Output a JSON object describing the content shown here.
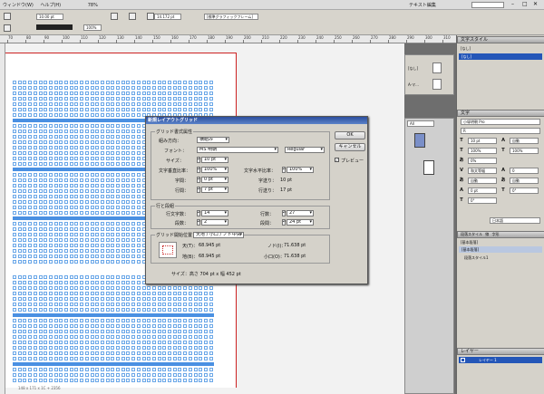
{
  "menubar": {
    "items": [
      "ウィンドウ(W)",
      "ヘルプ(H)"
    ],
    "zoom": "78%",
    "workspace": "テキスト編集"
  },
  "toolbar": {
    "font_size": "10.00 pt",
    "leading": "14.172 pt",
    "frame_type": "[標準グラフィックフレーム]",
    "percent": "100%"
  },
  "ruler": {
    "labels": [
      "70",
      "80",
      "90",
      "100",
      "110",
      "120",
      "130",
      "140",
      "150",
      "160",
      "170",
      "180",
      "190",
      "200",
      "210",
      "220",
      "230",
      "240",
      "250",
      "260",
      "270",
      "280",
      "290",
      "300",
      "310"
    ]
  },
  "status": {
    "text": "148 x 171 x 1C + 2356"
  },
  "dialog": {
    "title": "新規レイアウトグリッド",
    "grid_attrs_label": "グリッド書式属性",
    "direction_label": "組み方向：",
    "direction_value": "横組み",
    "font_label": "フォント：",
    "font_value": "MS 明朝",
    "style_value": "Regular",
    "size_label": "サイズ：",
    "size_value": "10 pt",
    "vscale_label": "文字垂直比率：",
    "vscale_value": "100%",
    "hscale_label": "文字水平比率：",
    "hscale_value": "100%",
    "charspace_label": "字間：",
    "charspace_value": "0 pt",
    "charspace_send_label": "字送り：",
    "charspace_send_value": "10 pt",
    "linespace_label": "行間：",
    "linespace_value": "7 pt",
    "linespace_send_label": "行送り：",
    "linespace_send_value": "17 pt",
    "lines_label": "行と段組",
    "chars_per_line_label": "行文字数：",
    "chars_per_line_value": "14",
    "lines_count_label": "行数：",
    "lines_count_value": "27",
    "columns_label": "段数：",
    "columns_value": "2",
    "gutter_label": "段間：",
    "gutter_value": "24 pt",
    "start_label": "グリッド開始位置",
    "start_value": "天地 / 小口 / ノド中央",
    "top_label": "天(T)：",
    "top_value": "68.945 pt",
    "inside_label": "ノド(I)：",
    "inside_value": "71.638 pt",
    "bottom_label": "地(B)：",
    "bottom_value": "68.945 pt",
    "outside_label": "小口(O)：",
    "outside_value": "71.638 pt",
    "size_summary": "サイズ：高さ 704 pt x 幅 452 pt",
    "ok": "OK",
    "cancel": "キャンセル",
    "preview": "プレビュー"
  },
  "pages_panel": {
    "none_label": "[なし]",
    "master_label": "A-マ..."
  },
  "mini_panel": {
    "tab": "All"
  },
  "char_style": {
    "title": "文字スタイル",
    "item": "[なし]",
    "selected": "[なし]"
  },
  "char_panel": {
    "title": "文字",
    "font": "小塚明朝 Pro",
    "weight": "R",
    "size": "10 pt",
    "leading": "自動",
    "scale_v": "100%",
    "scale_h": "100%",
    "tsume": "0%",
    "kerning": "和文等幅",
    "tracking": "0",
    "aki_before": "自動",
    "aki_after": "自動",
    "baseline": "0 pt",
    "skew": "0°",
    "rotate": "0°",
    "lang": "日本語"
  },
  "para_style": {
    "tabs": [
      "段落スタイル",
      "線",
      "字形"
    ],
    "item1": "[基本段落]",
    "item2": "[基本段落]",
    "item3": "段落スタイル1"
  },
  "layers": {
    "title": "レイヤー",
    "item": "レイヤー 1"
  }
}
